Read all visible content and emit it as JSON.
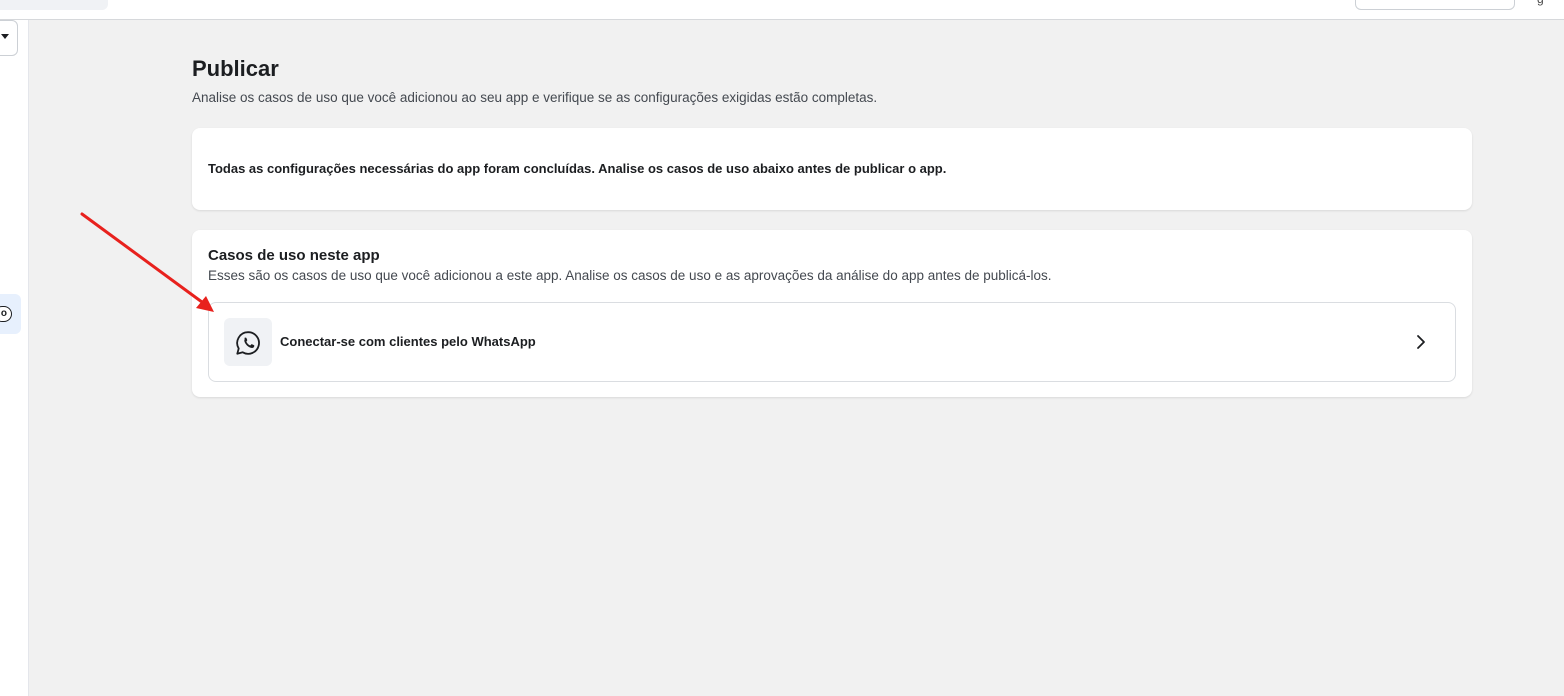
{
  "page": {
    "title": "Publicar",
    "subtitle": "Analise os casos de uso que você adicionou ao seu app e verifique se as configurações exigidas estão completas."
  },
  "status_card": {
    "message": "Todas as configurações necessárias do app foram concluídas. Analise os casos de uso abaixo antes de publicar o app."
  },
  "use_cases_card": {
    "heading": "Casos de uso neste app",
    "description": "Esses são os casos de uso que você adicionou a este app. Analise os casos de uso e as aprovações da análise do app antes de publicá-los.",
    "items": [
      {
        "label": "Conectar-se com clientes pelo WhatsApp",
        "icon": "whatsapp-icon"
      }
    ]
  },
  "sidebar": {
    "active_badge": "o"
  },
  "colors": {
    "background": "#f1f1f1",
    "card": "#ffffff",
    "annotation_arrow": "#e8211d",
    "sidebar_active": "#e7f0fd"
  }
}
